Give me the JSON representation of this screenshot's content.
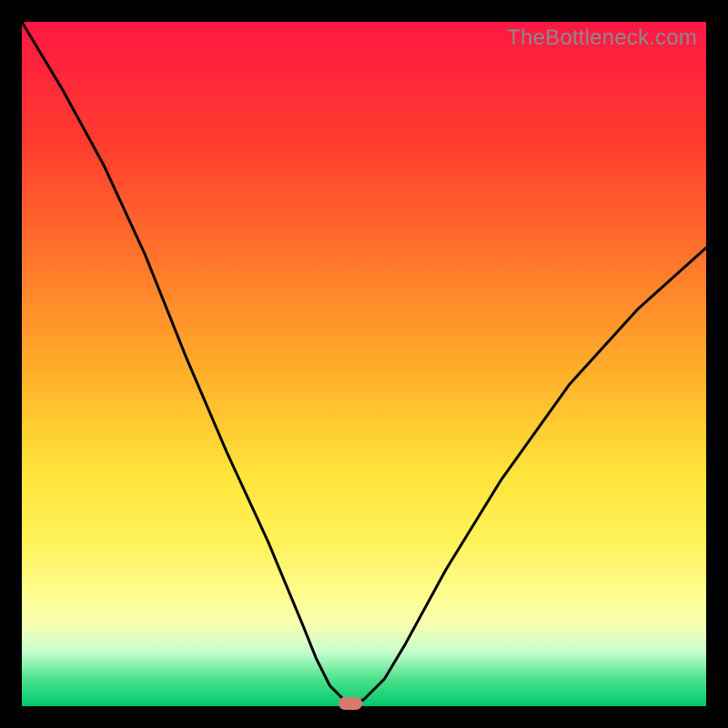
{
  "watermark": "TheBottleneck.com",
  "colors": {
    "frame": "#000000",
    "watermark": "#8a8a8a",
    "curve": "#000000",
    "marker": "#d77a6e",
    "gradient_top": "#ff1744",
    "gradient_bottom": "#00c86e"
  },
  "chart_data": {
    "type": "line",
    "title": "",
    "xlabel": "",
    "ylabel": "",
    "xlim": [
      0,
      100
    ],
    "ylim": [
      0,
      100
    ],
    "grid": false,
    "series": [
      {
        "name": "bottleneck-curve",
        "x": [
          0,
          6,
          12,
          18,
          24,
          30,
          36,
          41,
          43,
          45,
          47,
          48,
          50,
          53,
          56,
          62,
          70,
          80,
          90,
          100
        ],
        "values": [
          100,
          90,
          79,
          66,
          51,
          37,
          24,
          12,
          7,
          3,
          1,
          0,
          1,
          4,
          9,
          20,
          33,
          47,
          58,
          67
        ]
      }
    ],
    "annotations": [
      {
        "name": "min-marker",
        "x": 48,
        "y": 0
      }
    ]
  }
}
